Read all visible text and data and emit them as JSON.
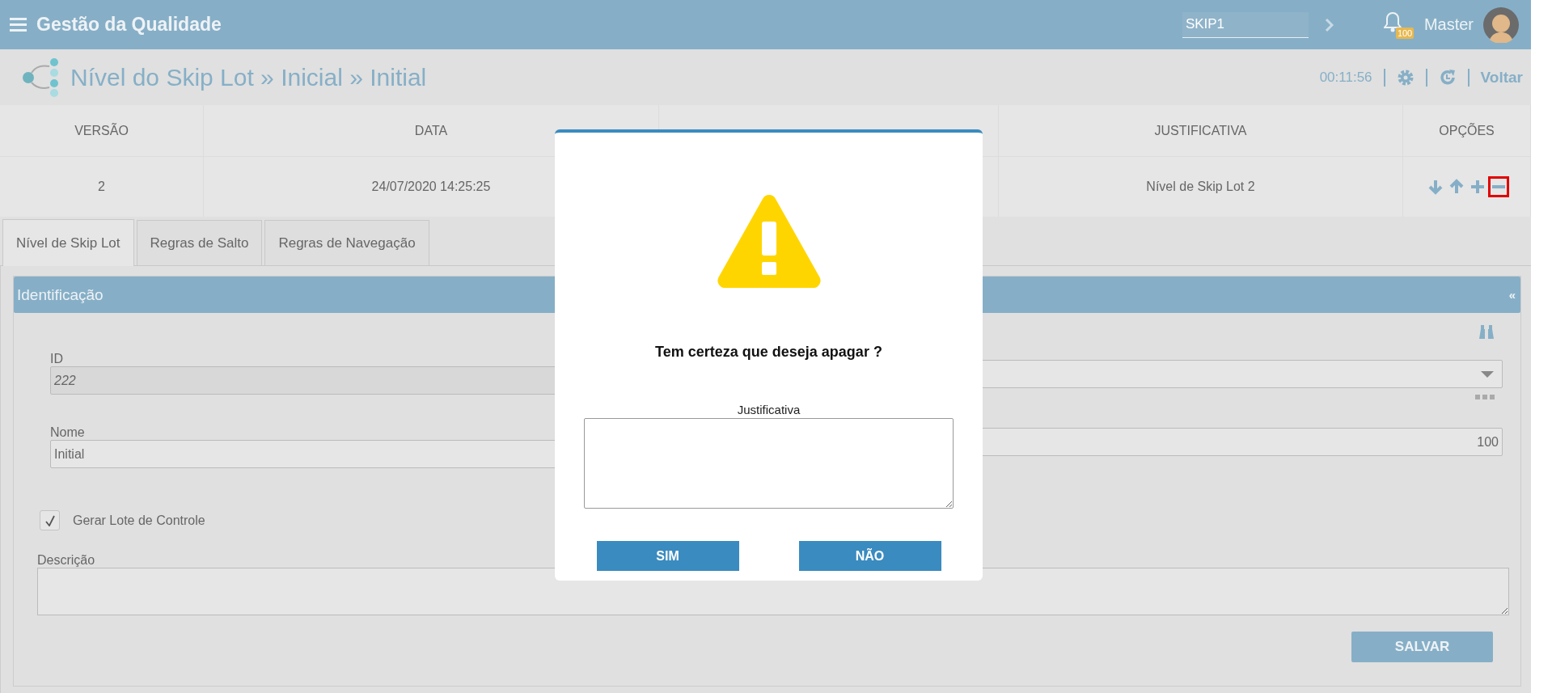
{
  "header": {
    "title": "Gestão da Qualidade",
    "search": {
      "value": "SKIP1"
    },
    "notifications": {
      "badge": "100"
    },
    "user": "Master"
  },
  "page": {
    "title": "Nível do Skip Lot » Inicial » Initial",
    "timer": "00:11:56",
    "back_link": "Voltar"
  },
  "table": {
    "columns": [
      {
        "label": "VERSÃO"
      },
      {
        "label": "DATA"
      },
      {},
      {
        "label": "JUSTIFICATIVA"
      },
      {
        "label": "OPÇÕES"
      }
    ],
    "rows": [
      {
        "version": "2",
        "date": "24/07/2020 14:25:25",
        "justification": "Nível de Skip Lot 2",
        "actions": [
          {
            "kind": "down",
            "highlighted": false
          },
          {
            "kind": "up",
            "highlighted": false
          },
          {
            "kind": "add",
            "highlighted": false
          },
          {
            "kind": "remove",
            "highlighted": true
          }
        ]
      }
    ]
  },
  "tabs": [
    {
      "label": "Nível de Skip Lot",
      "selected": true
    },
    {
      "label": "Regras de Salto",
      "selected": false
    },
    {
      "label": "Regras de Navegação",
      "selected": false
    }
  ],
  "panel": {
    "title": "Identificação",
    "collapse": "«",
    "left_fields": [
      {
        "label": "ID",
        "value": "222",
        "disabled": true
      },
      {
        "label": "Nome",
        "value": "Initial",
        "disabled": false
      }
    ],
    "right_fields": [
      {
        "kind": "select"
      },
      {
        "kind": "number",
        "value": "100"
      }
    ],
    "checkbox": {
      "label": "Gerar Lote de Controle",
      "checked": true
    },
    "description": {
      "label": "Descrição"
    },
    "save_button": "SALVAR"
  },
  "dialog": {
    "message": "Tem certeza que deseja apagar ?",
    "field_label": "Justificativa",
    "buttons": [
      "SIM",
      "NÃO"
    ]
  }
}
